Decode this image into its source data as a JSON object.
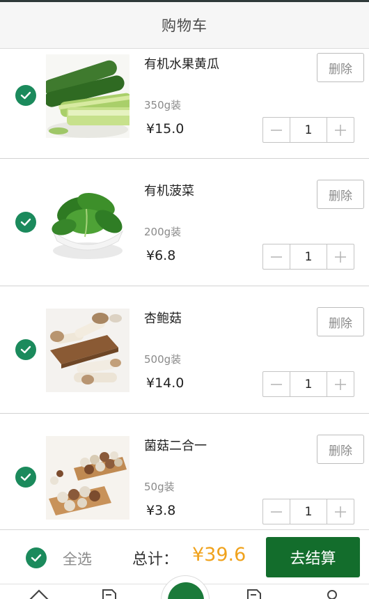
{
  "header": {
    "title": "购物车"
  },
  "items": [
    {
      "name": "有机水果黄瓜",
      "spec": "350g装",
      "price": "¥15.0",
      "qty": "1",
      "delete_label": "删除"
    },
    {
      "name": "有机菠菜",
      "spec": "200g装",
      "price": "¥6.8",
      "qty": "1",
      "delete_label": "删除"
    },
    {
      "name": "杏鲍菇",
      "spec": "500g装",
      "price": "¥14.0",
      "qty": "1",
      "delete_label": "删除"
    },
    {
      "name": "菌菇二合一",
      "spec": "50g装",
      "price": "¥3.8",
      "qty": "1",
      "delete_label": "删除"
    }
  ],
  "footer": {
    "select_all_label": "全选",
    "total_label": "总计：",
    "total_value": "¥39.6",
    "checkout_label": "去结算"
  },
  "colors": {
    "check_green": "#1b8a5c",
    "checkout_green": "#136d2c",
    "total_orange": "#f0a21c"
  },
  "icons": [
    "check-icon",
    "minus-icon",
    "plus-icon",
    "home-icon",
    "document-icon",
    "cart-icon",
    "user-icon"
  ]
}
